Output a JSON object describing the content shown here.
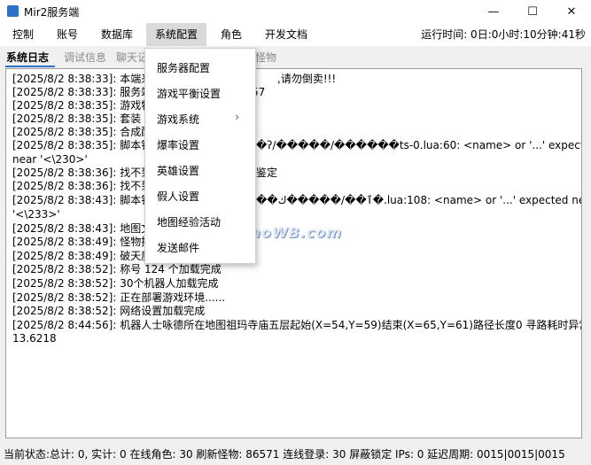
{
  "window": {
    "title": "Mir2服务端",
    "icons": {
      "app": "app-icon",
      "minimize": "minimize-icon",
      "maximize": "maximize-icon",
      "close": "close-icon"
    },
    "minimize_glyph": "—",
    "maximize_glyph": "☐",
    "close_glyph": "✕"
  },
  "menubar": {
    "items": [
      "控制",
      "账号",
      "数据库",
      "系统配置",
      "角色",
      "开发文档"
    ],
    "runtime": "运行时间: 0日:0小时:10分钟:41秒"
  },
  "tabs": [
    "系统日志",
    "调试信息",
    "聊天记",
    "怪物"
  ],
  "dropdown": {
    "items": [
      "服务器配置",
      "游戏平衡设置",
      "游戏系统",
      "爆率设置",
      "英雄设置",
      "假人设置",
      "地图经验活动",
      "发送邮件"
    ],
    "submenu_arrow": "›"
  },
  "log": [
    "[2025/8/2 8:38:33]: 本端来源",
    ",请勿倒卖!!!",
    "[2025/8/2 8:38:33]: 服务端b",
    "57",
    "[2025/8/2 8:38:35]: 游戏特效",
    "[2025/8/2 8:38:35]: 套装 42",
    "[2025/8/2 8:38:35]: 合成配方",
    "[2025/8/2 8:38:35]: 脚本错误",
    "�ʔ/�����/������ts-0.lua:60: <name> or '...' expected",
    "near '<\\230>'",
    "[2025/8/2 8:38:36]: 找不到脚",
    "鉴定",
    "[2025/8/2 8:38:36]: 找不到脚",
    "[2025/8/2 8:38:43]: 脚本错误",
    "��ٱ��/�����ك�.lua:108: <name> or '...' expected near",
    "'<\\233>'",
    "[2025/8/2 8:38:43]: 地图文件",
    "[2025/8/2 8:38:49]: 怪物掉落",
    "[2025/8/2 8:38:49]: 破天魔龙",
    "[2025/8/2 8:38:52]: 称号 124 个加载完成",
    "[2025/8/2 8:38:52]: 30个机器人加载完成",
    "[2025/8/2 8:38:52]: 正在部署游戏环境......",
    "[2025/8/2 8:38:52]: 网络设置加载完成",
    "[2025/8/2 8:44:56]: 机器人士咏德所在地图祖玛寺庙五层起始(X=54,Y=59)结束(X=65,Y=61)路径长度0 寻路耗时异常",
    "13.6218"
  ],
  "watermark": "LaoWB.com",
  "status": "当前状态:总计: 0, 实计: 0  在线角色: 30  刷新怪物: 86571  连线登录: 30  屏蔽锁定 IPs: 0  延迟周期: 0015|0015|0015"
}
